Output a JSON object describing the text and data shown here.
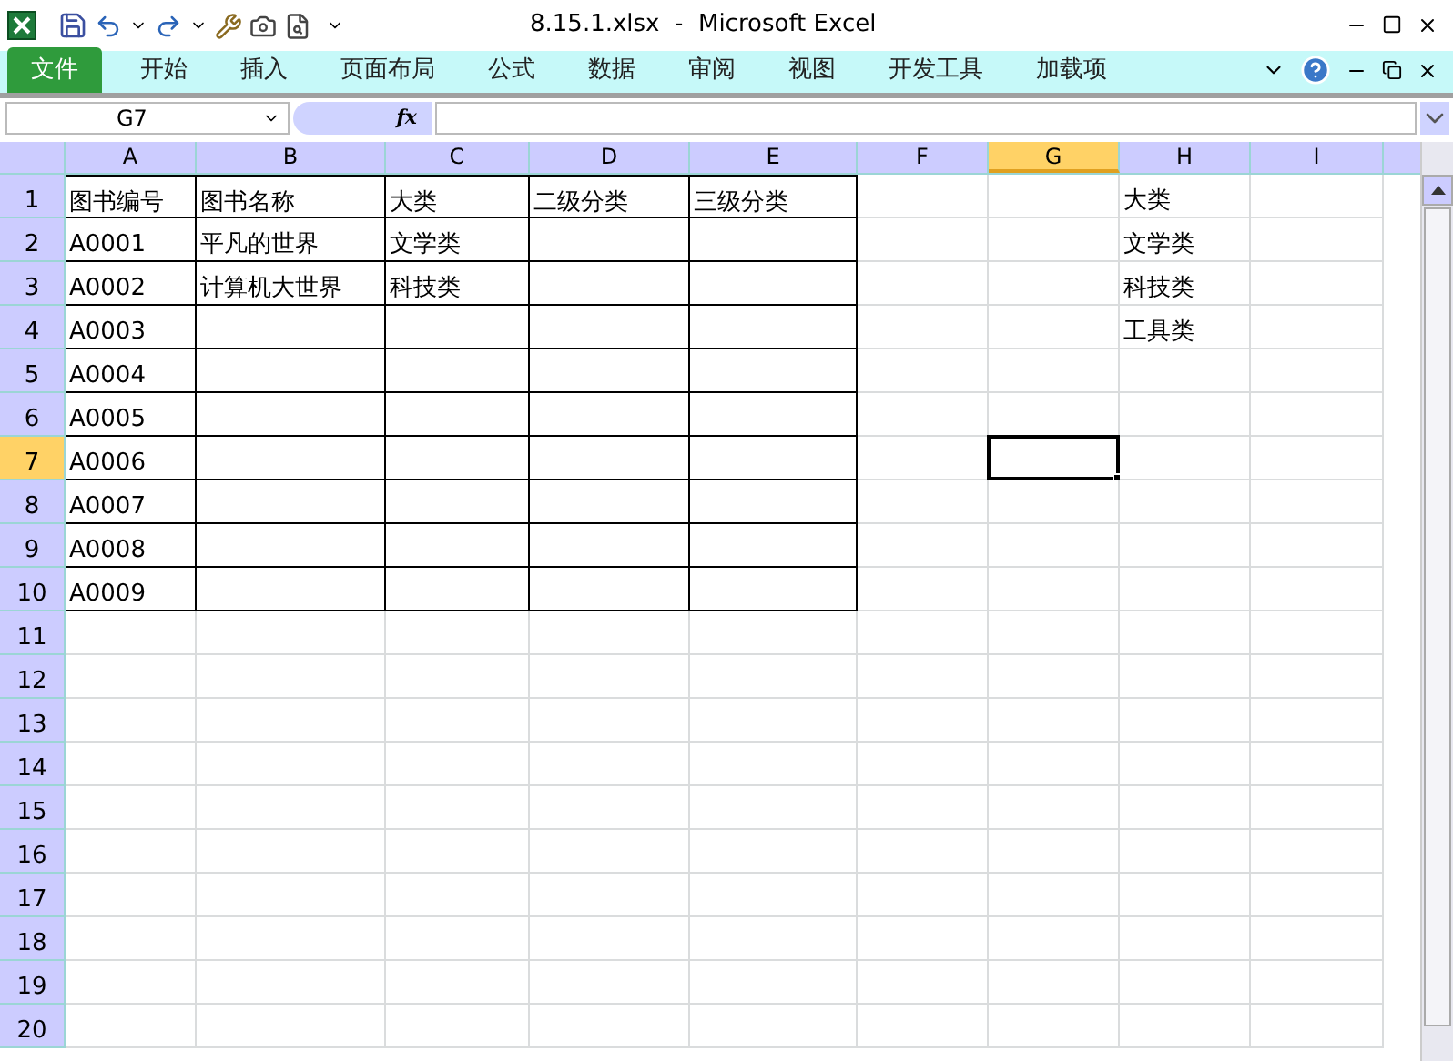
{
  "window": {
    "title": "8.15.1.xlsx  -  Microsoft Excel"
  },
  "ribbon_tabs": [
    {
      "label": "文件",
      "selected": true
    },
    {
      "label": "开始",
      "selected": false
    },
    {
      "label": "插入",
      "selected": false
    },
    {
      "label": "页面布局",
      "selected": false
    },
    {
      "label": "公式",
      "selected": false
    },
    {
      "label": "数据",
      "selected": false
    },
    {
      "label": "审阅",
      "selected": false
    },
    {
      "label": "视图",
      "selected": false
    },
    {
      "label": "开发工具",
      "selected": false
    },
    {
      "label": "加载项",
      "selected": false
    }
  ],
  "formula_bar": {
    "name_box": "G7",
    "fx": "fx"
  },
  "columns": [
    {
      "label": "A",
      "selected": false
    },
    {
      "label": "B",
      "selected": false
    },
    {
      "label": "C",
      "selected": false
    },
    {
      "label": "D",
      "selected": false
    },
    {
      "label": "E",
      "selected": false
    },
    {
      "label": "F",
      "selected": false
    },
    {
      "label": "G",
      "selected": true
    },
    {
      "label": "H",
      "selected": false
    },
    {
      "label": "I",
      "selected": false
    }
  ],
  "rows": [
    {
      "label": "1",
      "selected": false,
      "cells": [
        "图书编号",
        "图书名称",
        "大类",
        "二级分类",
        "三级分类"
      ],
      "column_h": "大类"
    },
    {
      "label": "2",
      "selected": false,
      "cells": [
        "A0001",
        "平凡的世界",
        "文学类"
      ],
      "column_h": "文学类"
    },
    {
      "label": "3",
      "selected": false,
      "cells": [
        "A0002",
        "计算机大世界",
        "科技类"
      ],
      "column_h": "科技类"
    },
    {
      "label": "4",
      "selected": false,
      "cells": [
        "A0003"
      ],
      "column_h": "工具类"
    },
    {
      "label": "5",
      "selected": false,
      "cells": [
        "A0004"
      ]
    },
    {
      "label": "6",
      "selected": false,
      "cells": [
        "A0005"
      ]
    },
    {
      "label": "7",
      "selected": true,
      "cells": [
        "A0006"
      ]
    },
    {
      "label": "8",
      "selected": false,
      "cells": [
        "A0007"
      ]
    },
    {
      "label": "9",
      "selected": false,
      "cells": [
        "A0008"
      ]
    },
    {
      "label": "10",
      "selected": false,
      "cells": [
        "A0009"
      ]
    },
    {
      "label": "11",
      "selected": false,
      "cells": []
    },
    {
      "label": "12",
      "selected": false,
      "cells": []
    },
    {
      "label": "13",
      "selected": false,
      "cells": []
    },
    {
      "label": "14",
      "selected": false,
      "cells": []
    },
    {
      "label": "15",
      "selected": false,
      "cells": []
    },
    {
      "label": "16",
      "selected": false,
      "cells": []
    },
    {
      "label": "17",
      "selected": false,
      "cells": []
    },
    {
      "label": "18",
      "selected": false,
      "cells": []
    },
    {
      "label": "19",
      "selected": false,
      "cells": []
    },
    {
      "label": "20",
      "selected": false,
      "cells": []
    }
  ]
}
